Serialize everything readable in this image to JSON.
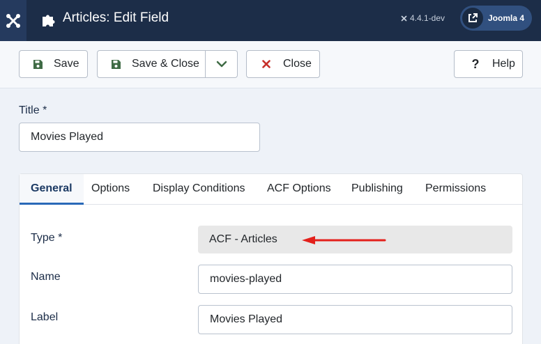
{
  "header": {
    "title": "Articles: Edit Field",
    "version": "4.4.1-dev",
    "joomla_label": "Joomla 4",
    "colors": {
      "bar": "#1c2d48",
      "pill": "#31507f"
    }
  },
  "toolbar": {
    "save_label": "Save",
    "save_close_label": "Save & Close",
    "close_label": "Close",
    "help_label": "Help",
    "colors": {
      "save_icon": "#3f6b45",
      "close_icon": "#c7302b"
    }
  },
  "form": {
    "title_label": "Title *",
    "title_value": "Movies Played"
  },
  "tabs": [
    {
      "label": "General",
      "active": true
    },
    {
      "label": "Options",
      "active": false
    },
    {
      "label": "Display Conditions",
      "active": false
    },
    {
      "label": "ACF Options",
      "active": false
    },
    {
      "label": "Publishing",
      "active": false
    },
    {
      "label": "Permissions",
      "active": false
    }
  ],
  "general": {
    "type_label": "Type *",
    "type_value": "ACF - Articles",
    "name_label": "Name",
    "name_value": "movies-played",
    "label_label": "Label",
    "label_value": "Movies Played"
  },
  "icons": {
    "logo": "joomla-logo-icon",
    "title": "puzzle-piece-icon",
    "external": "external-link-icon",
    "save": "floppy-disk-icon",
    "dropdown": "chevron-down-icon",
    "close": "x-icon",
    "help": "question-icon",
    "annotation": "red-arrow-icon"
  }
}
